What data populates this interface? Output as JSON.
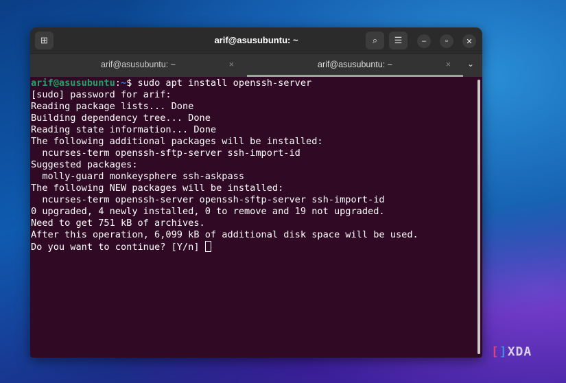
{
  "window": {
    "title": "arif@asusubuntu: ~"
  },
  "tabs": [
    {
      "label": "arif@asusubuntu: ~",
      "active": false
    },
    {
      "label": "arif@asusubuntu: ~",
      "active": true
    }
  ],
  "terminal": {
    "prompt_user": "arif@asusubuntu",
    "prompt_sep": ":",
    "prompt_path": "~",
    "prompt_sym": "$ ",
    "command": "sudo apt install openssh-server",
    "lines": [
      "[sudo] password for arif:",
      "Reading package lists... Done",
      "Building dependency tree... Done",
      "Reading state information... Done",
      "The following additional packages will be installed:",
      "  ncurses-term openssh-sftp-server ssh-import-id",
      "Suggested packages:",
      "  molly-guard monkeysphere ssh-askpass",
      "The following NEW packages will be installed:",
      "  ncurses-term openssh-server openssh-sftp-server ssh-import-id",
      "0 upgraded, 4 newly installed, 0 to remove and 19 not upgraded.",
      "Need to get 751 kB of archives.",
      "After this operation, 6,099 kB of additional disk space will be used."
    ],
    "last_prompt": "Do you want to continue? [Y/n] "
  },
  "watermark": {
    "text": "XDA"
  }
}
